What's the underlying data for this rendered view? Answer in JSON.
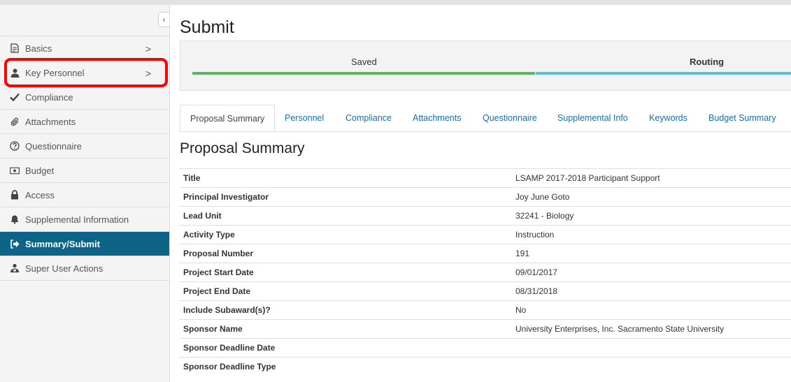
{
  "page": {
    "title": "Submit"
  },
  "sidebar": {
    "collapse_label": "‹",
    "items": [
      {
        "label": "Basics",
        "icon": "document-icon"
      },
      {
        "label": "Key Personnel",
        "icon": "person-icon"
      },
      {
        "label": "Compliance",
        "icon": "check-icon"
      },
      {
        "label": "Attachments",
        "icon": "paperclip-icon"
      },
      {
        "label": "Questionnaire",
        "icon": "question-circle-icon"
      },
      {
        "label": "Budget",
        "icon": "money-icon"
      },
      {
        "label": "Access",
        "icon": "lock-icon"
      },
      {
        "label": "Supplemental Information",
        "icon": "bell-icon"
      },
      {
        "label": "Summary/Submit",
        "icon": "sign-out-icon"
      },
      {
        "label": "Super User Actions",
        "icon": "super-user-icon"
      }
    ],
    "active_color": "#0e6486"
  },
  "status": {
    "steps": [
      {
        "label": "Saved",
        "color": "#5cb85c"
      },
      {
        "label": "Routing",
        "color": "#5bc0de"
      }
    ]
  },
  "tabs": [
    {
      "label": "Proposal Summary"
    },
    {
      "label": "Personnel"
    },
    {
      "label": "Compliance"
    },
    {
      "label": "Attachments"
    },
    {
      "label": "Questionnaire"
    },
    {
      "label": "Supplemental Info"
    },
    {
      "label": "Keywords"
    },
    {
      "label": "Budget Summary"
    }
  ],
  "summary": {
    "title": "Proposal Summary",
    "rows": [
      {
        "label": "Title",
        "value": "LSAMP 2017-2018 Participant Support"
      },
      {
        "label": "Principal Investigator",
        "value": "Joy June Goto"
      },
      {
        "label": "Lead Unit",
        "value": "32241 - Biology"
      },
      {
        "label": "Activity Type",
        "value": "Instruction"
      },
      {
        "label": "Proposal Number",
        "value": "191"
      },
      {
        "label": "Project Start Date",
        "value": "09/01/2017"
      },
      {
        "label": "Project End Date",
        "value": "08/31/2018"
      },
      {
        "label": "Include Subaward(s)?",
        "value": "No"
      },
      {
        "label": "Sponsor Name",
        "value": "University Enterprises, Inc. Sacramento State University"
      },
      {
        "label": "Sponsor Deadline Date",
        "value": ""
      },
      {
        "label": "Sponsor Deadline Type",
        "value": ""
      }
    ]
  }
}
